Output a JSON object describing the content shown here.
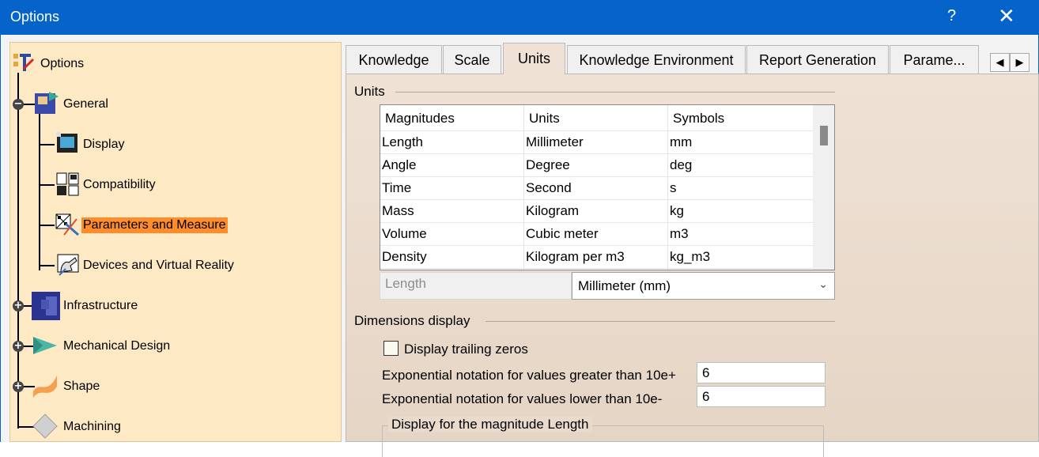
{
  "window": {
    "title": "Options",
    "help_label": "?",
    "close_label": "✕"
  },
  "tree": {
    "root": "Options",
    "items": [
      {
        "label": "General"
      },
      {
        "label": "Display"
      },
      {
        "label": "Compatibility"
      },
      {
        "label": "Parameters and Measure"
      },
      {
        "label": "Devices and Virtual Reality"
      },
      {
        "label": "Infrastructure"
      },
      {
        "label": "Mechanical Design"
      },
      {
        "label": "Shape"
      },
      {
        "label": "Machining"
      }
    ],
    "selected": "Parameters and Measure"
  },
  "tabs": [
    {
      "label": "Knowledge"
    },
    {
      "label": "Scale"
    },
    {
      "label": "Units"
    },
    {
      "label": "Knowledge Environment"
    },
    {
      "label": "Report Generation"
    },
    {
      "label": "Parame..."
    }
  ],
  "active_tab": "Units",
  "units_section": {
    "title": "Units",
    "columns": [
      "Magnitudes",
      "Units",
      "Symbols"
    ],
    "rows": [
      [
        "Length",
        "Millimeter",
        "mm"
      ],
      [
        "Angle",
        "Degree",
        "deg"
      ],
      [
        "Time",
        "Second",
        "s"
      ],
      [
        "Mass",
        "Kilogram",
        "kg"
      ],
      [
        "Volume",
        "Cubic meter",
        "m3"
      ],
      [
        "Density",
        "Kilogram per m3",
        "kg_m3"
      ]
    ],
    "selected_magnitude": "Length",
    "unit_select_value": "Millimeter (mm)"
  },
  "dimensions_section": {
    "title": "Dimensions display",
    "trailing_zeros_label": "Display trailing zeros",
    "trailing_zeros_checked": false,
    "exp_greater_label": "Exponential notation for values greater than 10e+",
    "exp_greater_value": "6",
    "exp_lower_label": "Exponential notation for values lower than 10e-",
    "exp_lower_value": "6",
    "magnitude_group_title": "Display for the magnitude Length"
  },
  "colors": {
    "titlebar": "#0563c9",
    "tree_background": "#fde9c4",
    "selection": "#ff8c2a"
  }
}
